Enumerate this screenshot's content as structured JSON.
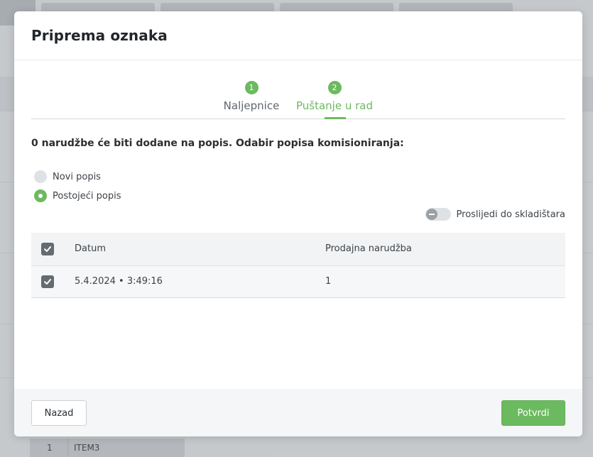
{
  "modal": {
    "title": "Priprema oznaka",
    "steps": [
      {
        "number": "1",
        "label": "Naljepnice",
        "active": false
      },
      {
        "number": "2",
        "label": "Puštanje u rad",
        "active": true
      }
    ],
    "info_text": "0 narudžbe će biti dodane na popis. Odabir popisa komisioniranja:",
    "radio_options": [
      {
        "label": "Novi popis",
        "selected": false
      },
      {
        "label": "Postojeći popis",
        "selected": true
      }
    ],
    "toggle": {
      "label": "Proslijedi do skladištara",
      "on": false
    },
    "table": {
      "columns": [
        "Datum",
        "Prodajna narudžba"
      ],
      "rows": [
        {
          "date": "5.4.2024 • 3:49:16",
          "order": "1",
          "checked": true
        }
      ]
    },
    "footer": {
      "back_label": "Nazad",
      "confirm_label": "Potvrdi"
    }
  },
  "background": {
    "row_number": "1",
    "row_item": "ITEM3"
  },
  "colors": {
    "accent": "#6cba5f",
    "checkbox": "#666b70",
    "footer_bg": "#f5f6f7"
  }
}
